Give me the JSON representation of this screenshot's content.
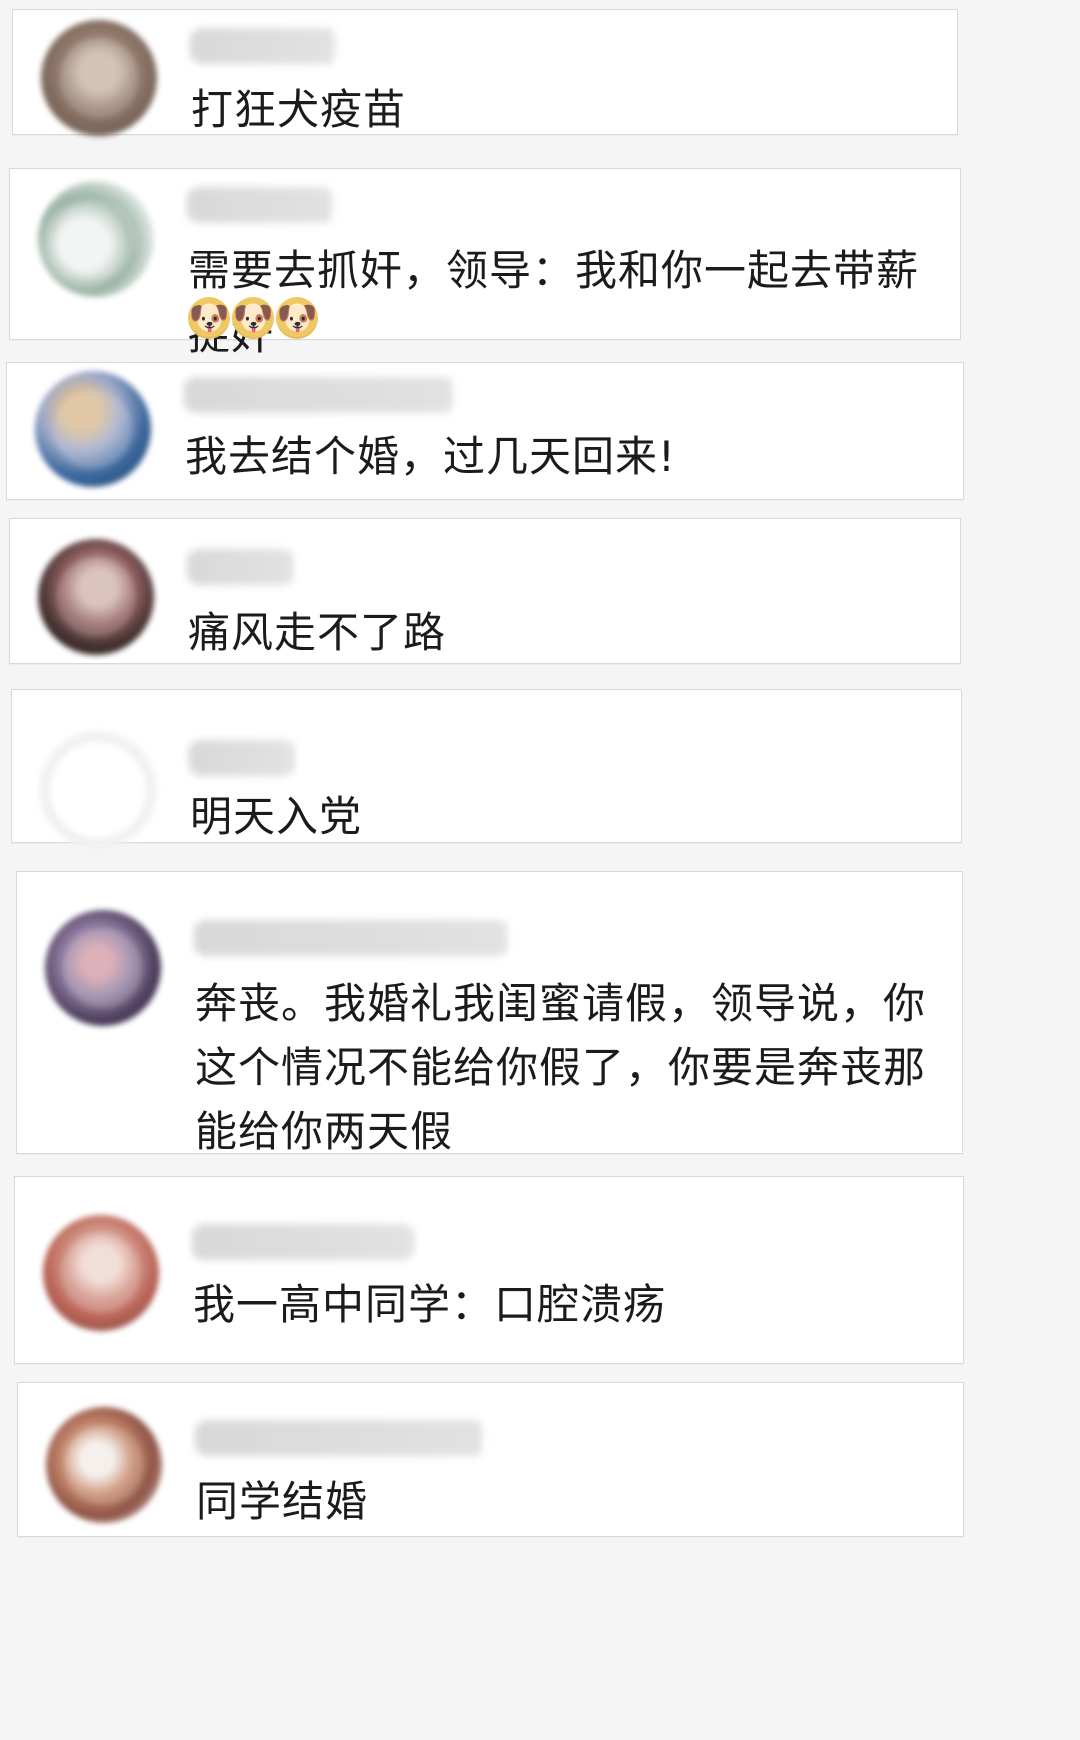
{
  "comments": [
    {
      "avatar_colors": [
        "#8e7465",
        "#c7b3a4"
      ],
      "text": "打狂犬疫苗"
    },
    {
      "avatar_colors": [
        "#7fa08c",
        "#f0f3f2"
      ],
      "text": "需要去抓奸，领导：我和你一起去带薪捉奸",
      "emojis": [
        "🐶",
        "🐶",
        "🐶"
      ]
    },
    {
      "avatar_colors": [
        "#315f98",
        "#d8b98f"
      ],
      "text": "我去结个婚，过几天回来!"
    },
    {
      "avatar_colors": [
        "#2c1d1d",
        "#d2b3ad"
      ],
      "text": "痛风走不了路"
    },
    {
      "avatar_colors": [
        "#f9f9f9",
        "#ffffff"
      ],
      "text": "明天入党"
    },
    {
      "avatar_colors": [
        "#7d6f88",
        "#d49ba8"
      ],
      "text": "奔丧。我婚礼我闺蜜请假，领导说，你这个情况不能给你假了，你要是奔丧那能给你两天假"
    },
    {
      "avatar_colors": [
        "#b4574a",
        "#f0d6cd"
      ],
      "text": "我一高中同学：口腔溃疡"
    },
    {
      "avatar_colors": [
        "#8a4c3d",
        "#f3ede8"
      ],
      "text": "同学结婚"
    }
  ]
}
